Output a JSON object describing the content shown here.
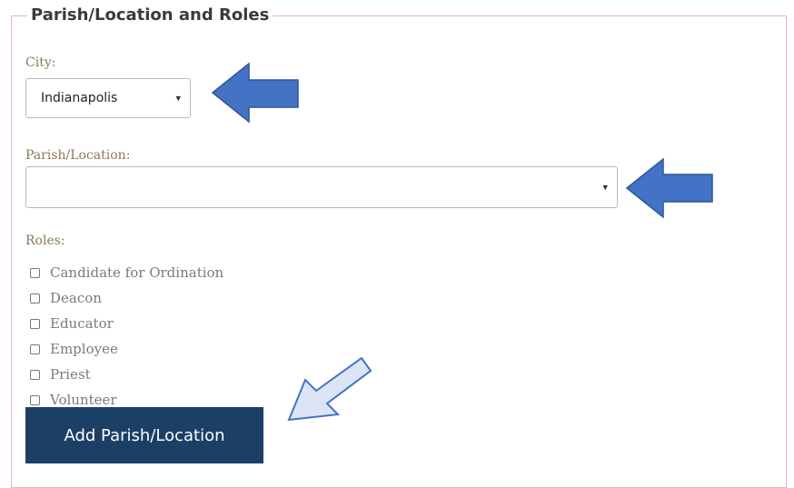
{
  "section": {
    "legend": "Parish/Location and Roles"
  },
  "city": {
    "label": "City:",
    "selected": "Indianapolis"
  },
  "parish": {
    "label": "Parish/Location:",
    "selected": ""
  },
  "roles": {
    "label": "Roles:",
    "items": [
      {
        "label": "Candidate for Ordination",
        "checked": false
      },
      {
        "label": "Deacon",
        "checked": false
      },
      {
        "label": "Educator",
        "checked": false
      },
      {
        "label": "Employee",
        "checked": false
      },
      {
        "label": "Priest",
        "checked": false
      },
      {
        "label": "Volunteer",
        "checked": false
      }
    ]
  },
  "add_button": {
    "label": "Add Parish/Location"
  },
  "annotations": {
    "arrow_color": "#4472c4",
    "arrow_light_fill": "#dbe5f5"
  }
}
